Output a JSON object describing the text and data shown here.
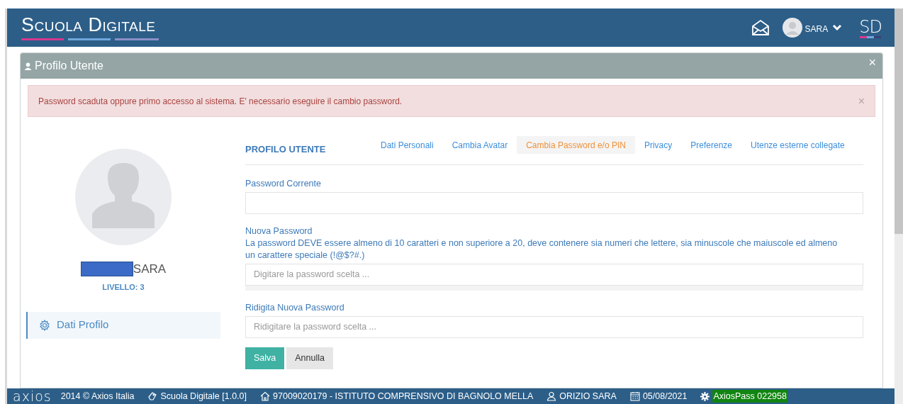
{
  "header": {
    "logo_title": "Scuola Digitale",
    "user_name": "SARA",
    "logo_mark": "SD"
  },
  "panel": {
    "title": "Profilo Utente",
    "close_glyph": "×",
    "alert_close_glyph": "×",
    "alert": "Password scaduta oppure primo accesso al sistema. E' necessario eseguire il cambio password.",
    "profile": {
      "name": "SARA",
      "level_text": "LIVELLO: 3",
      "menu": [
        {
          "label": "Dati Profilo",
          "selected": true
        }
      ]
    },
    "section_title": "PROFILO UTENTE",
    "tabs": [
      {
        "label": "Dati Personali",
        "selected": false
      },
      {
        "label": "Cambia Avatar",
        "selected": false
      },
      {
        "label": "Cambia Password e/o PIN",
        "selected": true
      },
      {
        "label": "Privacy",
        "selected": false
      },
      {
        "label": "Preferenze",
        "selected": false
      },
      {
        "label": "Utenze esterne collegate",
        "selected": false
      }
    ],
    "fields": [
      {
        "label": "Password Corrente"
      },
      {
        "label": "Nuova Password",
        "hint": "La password DEVE essere almeno di 10 caratteri e non superiore a 20, deve contenere sia numeri che lettere, sia minuscole che maiuscole ed almeno un carattere speciale (!@$?#.)",
        "placeholder": "Digitare la password scelta ...",
        "strength_meter": true
      },
      {
        "label": "Ridigita Nuova Password",
        "placeholder": "Ridigitare la password scelta ..."
      }
    ],
    "buttons": [
      {
        "label": "Salva",
        "kind": "primary"
      },
      {
        "label": "Annulla",
        "kind": "secondary"
      }
    ]
  },
  "footer": [
    {
      "kind": "logo",
      "text": "axios"
    },
    {
      "kind": "copyright",
      "text": "2014 © Axios Italia"
    },
    {
      "kind": "app",
      "text": "Scuola Digitale [1.0.0]"
    },
    {
      "kind": "school",
      "text": "97009020179 - ISTITUTO COMPRENSIVO DI BAGNOLO MELLA"
    },
    {
      "kind": "user",
      "text": "ORIZIO SARA"
    },
    {
      "kind": "date",
      "text": "05/08/2021"
    },
    {
      "kind": "pass",
      "text": "AxiosPass 022958"
    }
  ]
}
